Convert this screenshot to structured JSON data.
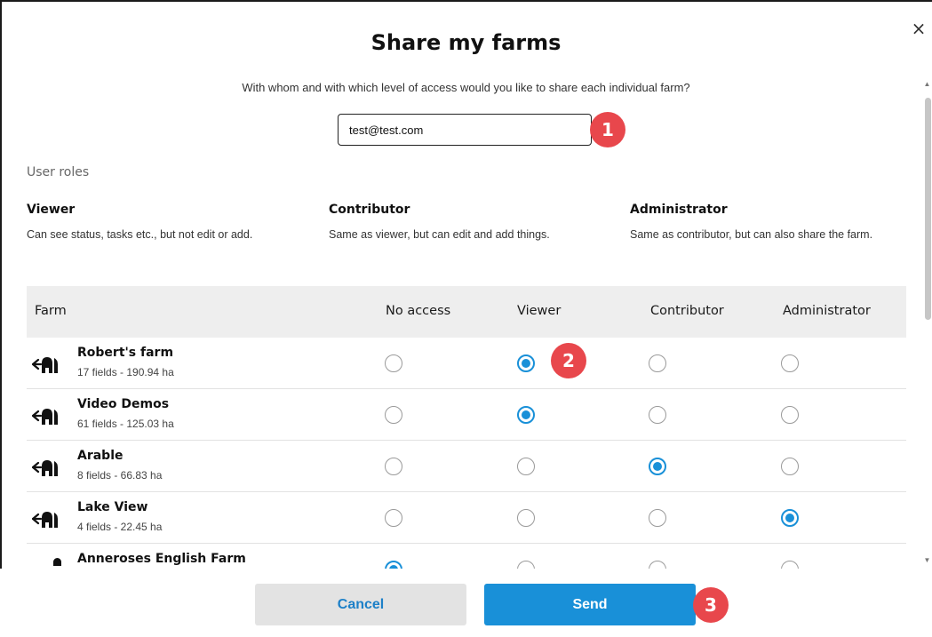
{
  "dialog": {
    "title": "Share my farms",
    "subtitle": "With whom and with which level of access would you like to share each individual farm?",
    "close_symbol": "×",
    "email_value": "test@test.com"
  },
  "badges": [
    "1",
    "2",
    "3"
  ],
  "roles": {
    "heading": "User roles",
    "items": [
      {
        "name": "Viewer",
        "description": "Can see status, tasks etc., but not edit or add."
      },
      {
        "name": "Contributor",
        "description": "Same as viewer, but can edit and add things."
      },
      {
        "name": "Administrator",
        "description": "Same as contributor, but can also share the farm."
      }
    ]
  },
  "table": {
    "headers": [
      "Farm",
      "No access",
      "Viewer",
      "Contributor",
      "Administrator"
    ],
    "rows": [
      {
        "name": "Robert's farm",
        "meta": "17 fields - 190.94 ha",
        "access": "Viewer"
      },
      {
        "name": "Video Demos",
        "meta": "61 fields - 125.03 ha",
        "access": "Viewer"
      },
      {
        "name": "Arable",
        "meta": "8 fields - 66.83 ha",
        "access": "Contributor"
      },
      {
        "name": "Lake View",
        "meta": "4 fields - 22.45 ha",
        "access": "Administrator"
      },
      {
        "name": "Anneroses English Farm",
        "meta": "",
        "access": "No access"
      }
    ]
  },
  "buttons": {
    "cancel_label": "Cancel",
    "send_label": "Send"
  },
  "colors": {
    "accent": "#1990d8",
    "badge": "#e8474c",
    "header_bg": "#eeeeee",
    "cancel_bg": "#e3e3e3"
  },
  "icons": {
    "farm": "farm-share-icon",
    "close": "close-icon"
  }
}
